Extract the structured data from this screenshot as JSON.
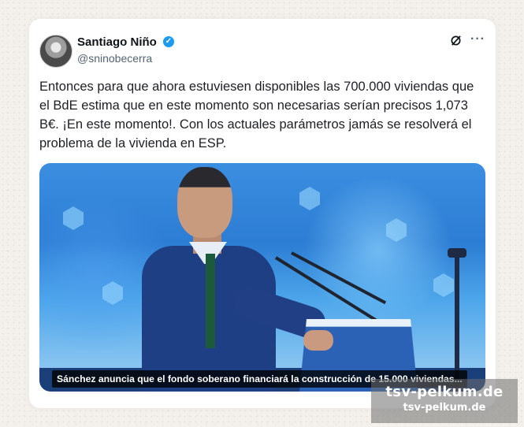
{
  "tweet": {
    "author_name": "Santiago Niño",
    "author_handle": "@sninobecerra",
    "text": "Entonces para que ahora estuviesen disponibles las 700.000 viviendas que el BdE estima que en este momento son necesarias serían precisos 1,073 B€. ¡En este momento!. Con los actuales parámetros jamás se resolverá el problema de la vivienda en ESP.",
    "more_label": "···",
    "verified_mark": "✓"
  },
  "media": {
    "caption": "Sánchez anuncia que el fondo soberano financiará la construcción de 15.000 viviendas..."
  },
  "watermark": {
    "line1": "tsv-pelkum.de",
    "line2": "tsv-pelkum.de"
  },
  "colors": {
    "verified": "#1d9bf0",
    "name_text": "#0f1419",
    "handle_text": "#536471"
  },
  "icons": [
    "avatar",
    "verified-badge-icon",
    "grok-icon",
    "more-options-icon"
  ]
}
